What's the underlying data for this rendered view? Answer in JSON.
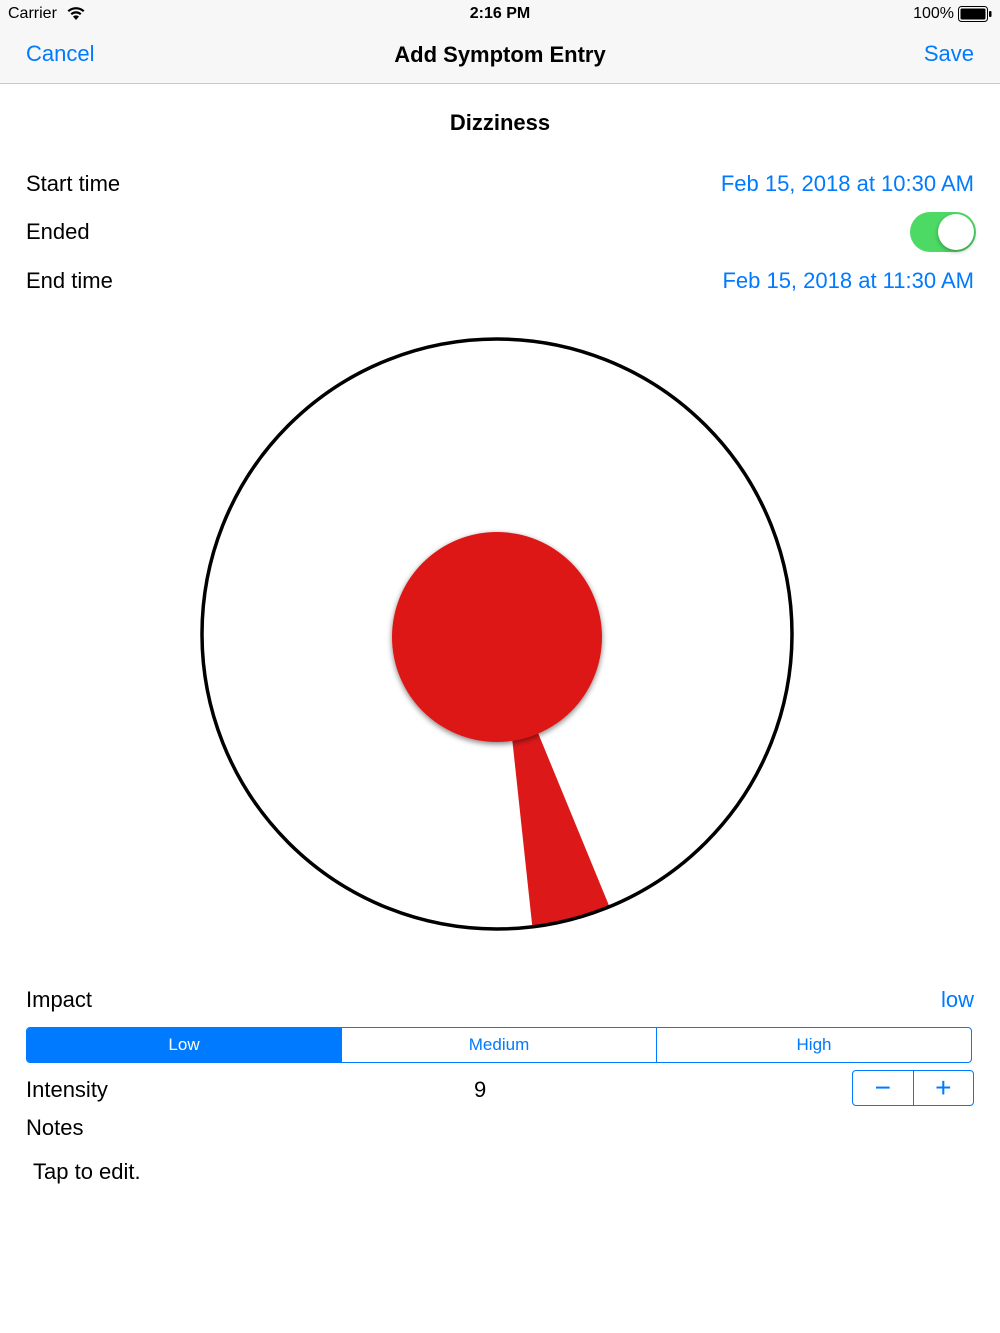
{
  "status_bar": {
    "carrier": "Carrier",
    "time": "2:16 PM",
    "battery_percent": "100%"
  },
  "nav": {
    "cancel_label": "Cancel",
    "title": "Add Symptom Entry",
    "save_label": "Save"
  },
  "symptom": {
    "name": "Dizziness"
  },
  "start_time": {
    "label": "Start time",
    "value": "Feb 15, 2018 at 10:30 AM"
  },
  "ended": {
    "label": "Ended",
    "on": true
  },
  "end_time": {
    "label": "End time",
    "value": "Feb 15, 2018 at 11:30 AM"
  },
  "dial": {
    "indicator_color": "#dd1818"
  },
  "impact": {
    "label": "Impact",
    "value": "low",
    "segments": [
      "Low",
      "Medium",
      "High"
    ],
    "selected": "Low"
  },
  "intensity": {
    "label": "Intensity",
    "value": "9",
    "decrement": "−",
    "increment": "+"
  },
  "notes": {
    "label": "Notes",
    "placeholder": "Tap to edit."
  },
  "colors": {
    "accent": "#007aff",
    "toggle_on": "#4cd964"
  }
}
